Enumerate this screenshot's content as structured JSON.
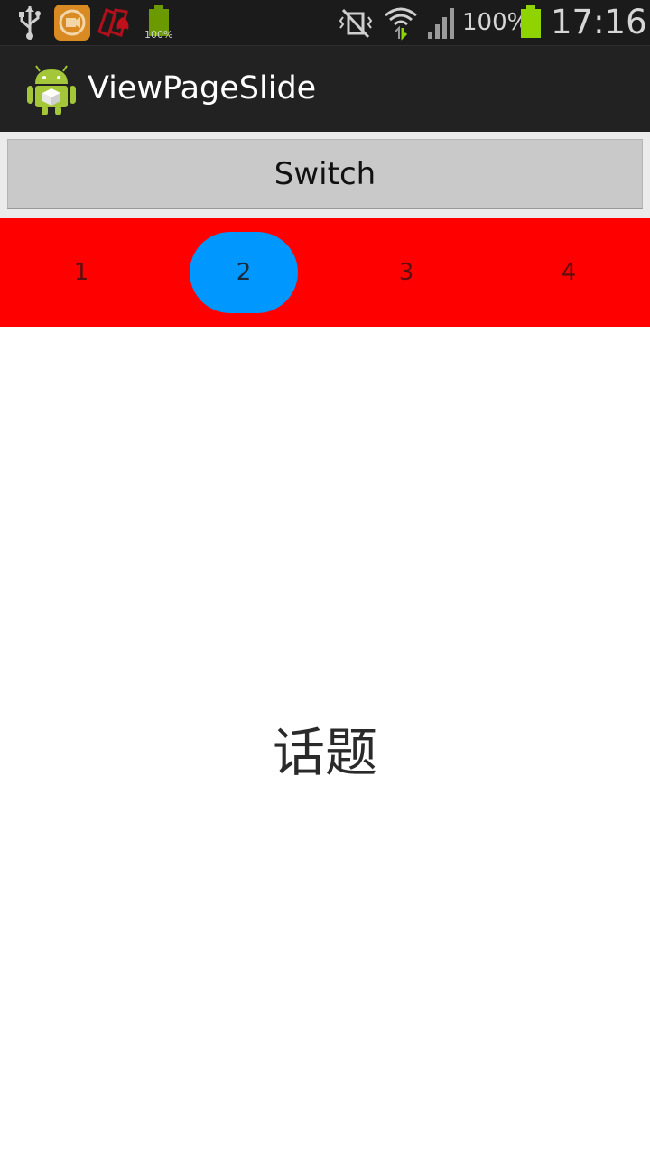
{
  "status_bar": {
    "battery_small_label": "100%",
    "battery_percent": "100%",
    "time": "17:16",
    "icons": [
      "usb-icon",
      "app-notification-icon",
      "cards-app-icon",
      "battery-full-icon",
      "mute-vibrate-icon",
      "wifi-icon",
      "signal-icon",
      "battery-icon"
    ]
  },
  "action_bar": {
    "title": "ViewPageSlide",
    "icon": "android-app-icon"
  },
  "switch_button": {
    "label": "Switch"
  },
  "tabs": {
    "items": [
      {
        "label": "1"
      },
      {
        "label": "2"
      },
      {
        "label": "3"
      },
      {
        "label": "4"
      }
    ],
    "selected_index": 1
  },
  "page": {
    "text": "话题"
  },
  "colors": {
    "status_bar_bg": "#1b1b1b",
    "action_bar_bg": "#222222",
    "tab_strip_bg": "#ff0000",
    "tab_selected_bg": "#0098ff",
    "button_bg": "#c9c9c9",
    "battery_green": "#8fd400"
  }
}
